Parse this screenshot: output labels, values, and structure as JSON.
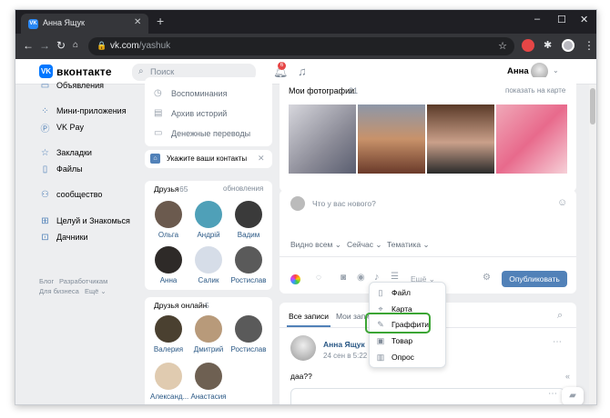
{
  "browser": {
    "tab_title": "Анна Ящук",
    "tab_favicon": "VK",
    "url_host": "vk.com",
    "url_path": "/yashuk"
  },
  "header": {
    "logo_text": "вконтакте",
    "search_placeholder": "Поиск",
    "notifications_count": "6",
    "user_name": "Анна"
  },
  "left_menu": {
    "items": [
      {
        "label": "Объявления",
        "icon": "ads-icon"
      },
      {
        "label": "Мини-приложения",
        "icon": "apps-icon"
      },
      {
        "label": "VK Pay",
        "icon": "vkpay-icon"
      },
      {
        "label": "Закладки",
        "icon": "bookmark-icon"
      },
      {
        "label": "Файлы",
        "icon": "file-icon"
      },
      {
        "label": "сообщество",
        "icon": "community-icon"
      },
      {
        "label": "Целуй и Знакомься",
        "icon": "game-icon"
      },
      {
        "label": "Дачники",
        "icon": "gamepad-icon"
      }
    ],
    "footer": [
      "Блог",
      "Разработчикам",
      "Для бизнеса",
      "Ещё ⌄"
    ]
  },
  "middle": {
    "quick_links": [
      "Воспоминания",
      "Архив историй",
      "Денежные переводы"
    ],
    "contacts_prompt": "Укажите ваши контакты",
    "friends_title": "Друзья",
    "friends_count": "65",
    "friends_updates": "обновления",
    "friends": [
      "Ольга",
      "Андрій",
      "Вадим",
      "Анна",
      "Салик",
      "Ростислав"
    ],
    "online_title": "Друзья онлайн",
    "online_count": "5",
    "online": [
      "Валерия",
      "Дмитрий",
      "Ростислав",
      "Александ...",
      "Анастасия"
    ]
  },
  "photos": {
    "title": "Мои фотографии",
    "count": "21",
    "map_link": "показать на карте"
  },
  "composer": {
    "placeholder": "Что у вас нового?",
    "visibility": "Видно всем",
    "time": "Сейчас",
    "topic": "Тематика",
    "more": "Ещё",
    "publish": "Опубликовать"
  },
  "attach_menu": [
    "Файл",
    "Карта",
    "Граффити",
    "Товар",
    "Опрос"
  ],
  "feed": {
    "tabs": [
      "Все записи",
      "Мои записи"
    ],
    "post_author": "Анна Ящук",
    "post_date": "24 сен в 5:22",
    "post_text": "даа??"
  },
  "colors": {
    "vk_blue": "#0077ff",
    "link": "#2a5885",
    "highlight": "#3ba534",
    "page_bg": "#edeef0"
  }
}
